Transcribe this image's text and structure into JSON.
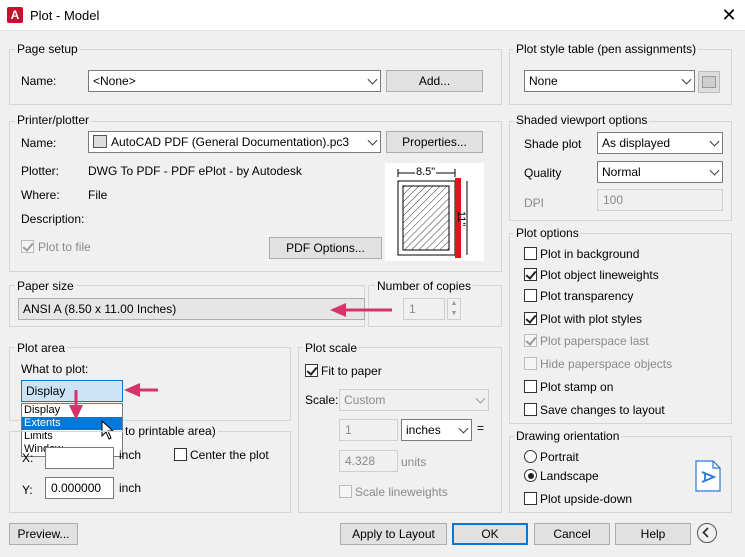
{
  "window": {
    "title": "Plot - Model",
    "app_icon_letter": "A"
  },
  "page_setup": {
    "label": "Page setup",
    "name_label": "Name:",
    "name_value": "<None>",
    "add_button": "Add..."
  },
  "printer": {
    "label": "Printer/plotter",
    "name_label": "Name:",
    "name_value": "AutoCAD PDF (General Documentation).pc3",
    "properties_button": "Properties...",
    "plotter_label": "Plotter:",
    "plotter_value": "DWG To PDF - PDF ePlot - by Autodesk",
    "where_label": "Where:",
    "where_value": "File",
    "description_label": "Description:",
    "plot_to_file": "Plot to file",
    "pdf_options_button": "PDF Options...",
    "preview_width": "8.5\"",
    "preview_height": "11\""
  },
  "paper_size": {
    "label": "Paper size",
    "value": "ANSI A (8.50 x 11.00 Inches)"
  },
  "copies": {
    "label": "Number of copies",
    "value": "1"
  },
  "plot_area": {
    "label": "Plot area",
    "what_label": "What to plot:",
    "selected": "Display",
    "options": [
      "Display",
      "Extents",
      "Limits",
      "Window"
    ],
    "highlighted": "Extents"
  },
  "plot_offset": {
    "label_visible": "to printable area)",
    "x_label": "X:",
    "x_unit": "inch",
    "y_label": "Y:",
    "y_value": "0.000000",
    "y_unit": "inch",
    "center": "Center the plot"
  },
  "plot_scale": {
    "label": "Plot scale",
    "fit": "Fit to paper",
    "scale_label": "Scale:",
    "scale_value": "Custom",
    "num": "1",
    "units": "inches",
    "equals": "=",
    "den": "4.328",
    "den_units": "units",
    "lineweights": "Scale lineweights"
  },
  "pen": {
    "label": "Plot style table (pen assignments)",
    "value": "None"
  },
  "shaded": {
    "label": "Shaded viewport options",
    "shade_label": "Shade plot",
    "shade_value": "As displayed",
    "quality_label": "Quality",
    "quality_value": "Normal",
    "dpi_label": "DPI",
    "dpi_value": "100"
  },
  "options": {
    "label": "Plot options",
    "items": [
      {
        "text": "Plot in background",
        "checked": false,
        "disabled": false
      },
      {
        "text": "Plot object lineweights",
        "checked": true,
        "disabled": false
      },
      {
        "text": "Plot transparency",
        "checked": false,
        "disabled": false
      },
      {
        "text": "Plot with plot styles",
        "checked": true,
        "disabled": false
      },
      {
        "text": "Plot paperspace last",
        "checked": true,
        "disabled": true
      },
      {
        "text": "Hide paperspace objects",
        "checked": false,
        "disabled": true
      },
      {
        "text": "Plot stamp on",
        "checked": false,
        "disabled": false
      },
      {
        "text": "Save changes to layout",
        "checked": false,
        "disabled": false
      }
    ]
  },
  "orientation": {
    "label": "Drawing orientation",
    "portrait": "Portrait",
    "landscape": "Landscape",
    "upside": "Plot upside-down"
  },
  "footer": {
    "preview": "Preview...",
    "apply": "Apply to Layout",
    "ok": "OK",
    "cancel": "Cancel",
    "help": "Help"
  },
  "colors": {
    "accent": "#0078d7",
    "arrow": "#d6336c",
    "brand": "#c8102e"
  }
}
